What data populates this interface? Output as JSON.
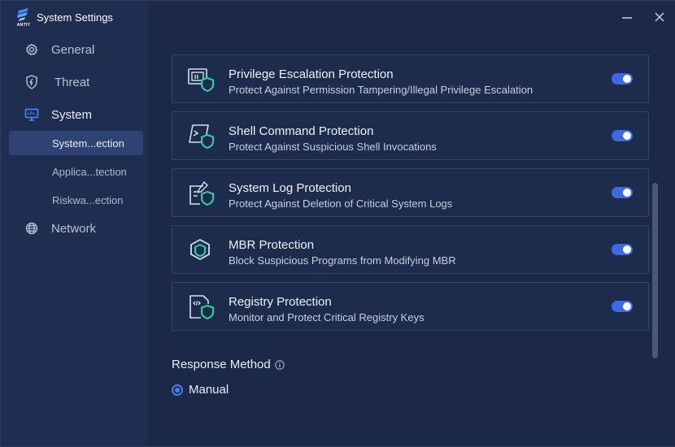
{
  "app": {
    "title": "System Settings",
    "logo_text": "ANTIY"
  },
  "sidebar": {
    "items": [
      {
        "label": "General",
        "icon": "gear-icon"
      },
      {
        "label": "Threat",
        "icon": "shield-bolt-icon"
      },
      {
        "label": "System",
        "icon": "monitor-icon"
      },
      {
        "label": "Network",
        "icon": "globe-icon"
      }
    ],
    "sub_items": [
      {
        "label": "System...ection",
        "selected": true
      },
      {
        "label": "Applica...tection",
        "selected": false
      },
      {
        "label": "Riskwa...ection",
        "selected": false
      }
    ]
  },
  "protections": [
    {
      "title": "Privilege Escalation Protection",
      "desc": "Protect Against Permission Tampering/Illegal Privilege Escalation",
      "icon": "privilege-shield-icon",
      "enabled": true
    },
    {
      "title": "Shell Command Protection",
      "desc": "Protect Against Suspicious Shell Invocations",
      "icon": "terminal-shield-icon",
      "enabled": true
    },
    {
      "title": "System Log Protection",
      "desc": "Protect Against Deletion of Critical System Logs",
      "icon": "log-shield-icon",
      "enabled": true
    },
    {
      "title": "MBR Protection",
      "desc": "Block Suspicious Programs from Modifying MBR",
      "icon": "hexagon-shield-icon",
      "enabled": true
    },
    {
      "title": "Registry Protection",
      "desc": "Monitor and Protect Critical Registry Keys",
      "icon": "registry-shield-icon",
      "enabled": true
    }
  ],
  "response": {
    "title": "Response Method",
    "option": "Manual",
    "selected": true
  },
  "colors": {
    "accent": "#3c6ae3",
    "shield": "#2fd1a0",
    "icon_line": "#cfe3f2"
  }
}
